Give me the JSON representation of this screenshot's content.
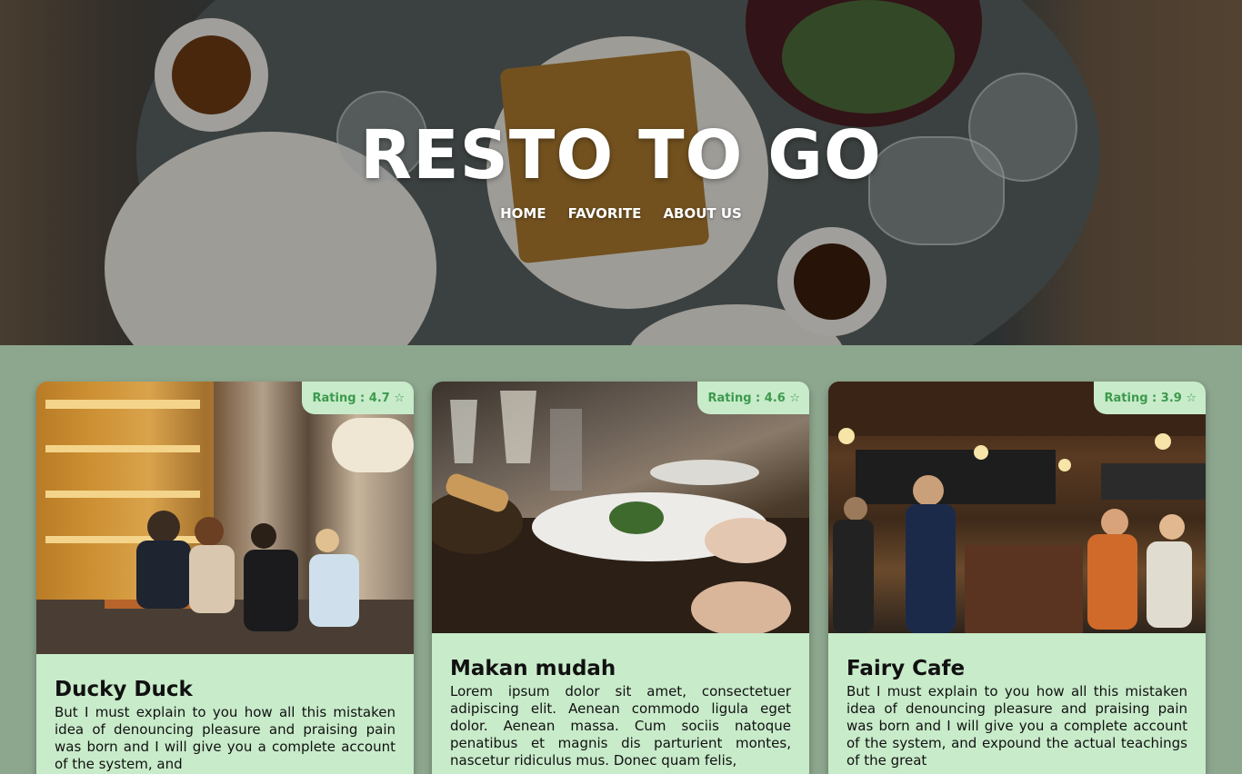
{
  "site": {
    "brand": "RESTO TO GO",
    "nav": [
      "HOME",
      "FAVORITE",
      "ABOUT US"
    ]
  },
  "restaurants": [
    {
      "name": "Ducky Duck",
      "rating": "Rating : 4.7 ☆",
      "description": "But I must explain to you how all this mistaken idea of denouncing pleasure and praising pain was born and I will give you a complete account of the system, and"
    },
    {
      "name": "Makan mudah",
      "rating": "Rating : 4.6 ☆",
      "description": "Lorem ipsum dolor sit amet, consectetuer adipiscing elit. Aenean commodo ligula eget dolor. Aenean massa. Cum sociis natoque penatibus et magnis dis parturient montes, nascetur ridiculus mus. Donec quam felis,"
    },
    {
      "name": "Fairy Cafe",
      "rating": "Rating : 3.9 ☆",
      "description": "But I must explain to you how all this mistaken idea of denouncing pleasure and praising pain was born and I will give you a complete account of the system, and expound the actual teachings of the great"
    }
  ]
}
